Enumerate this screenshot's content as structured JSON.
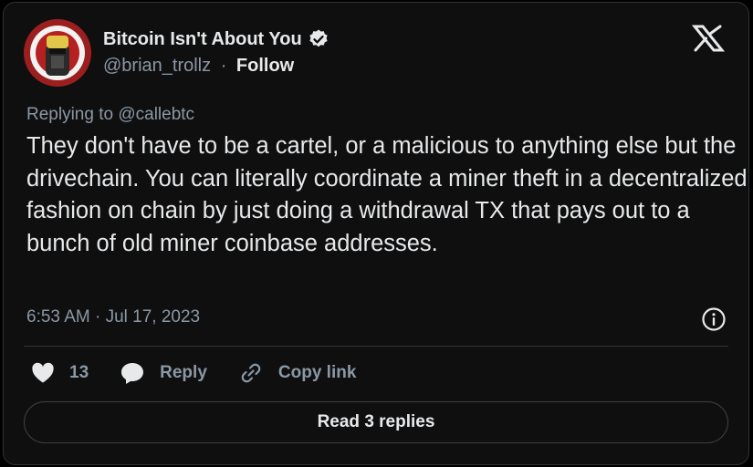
{
  "author": {
    "name": "Bitcoin Isn't About You",
    "handle": "@brian_trollz",
    "separator": "·",
    "follow_label": "Follow",
    "verified": true
  },
  "post": {
    "replying_to": "Replying to @callebtc",
    "text": "They don't have to be a cartel, or a malicious to anything else but the drivechain. You can literally coordinate a miner theft in a decentralized fashion on chain by just doing a withdrawal TX that pays out to a bunch of old miner coinbase addresses.",
    "timestamp": "6:53 AM · Jul 17, 2023"
  },
  "actions": {
    "like_count": "13",
    "reply_label": "Reply",
    "copy_link_label": "Copy link"
  },
  "read_replies_label": "Read 3 replies",
  "icons": [
    "verified-badge-icon",
    "x-logo-icon",
    "info-icon",
    "heart-icon",
    "reply-bubble-icon",
    "link-icon"
  ],
  "colors": {
    "background": "#000000",
    "text": "#e7e9ea",
    "muted": "#8b98a5",
    "border": "#2f3336"
  }
}
